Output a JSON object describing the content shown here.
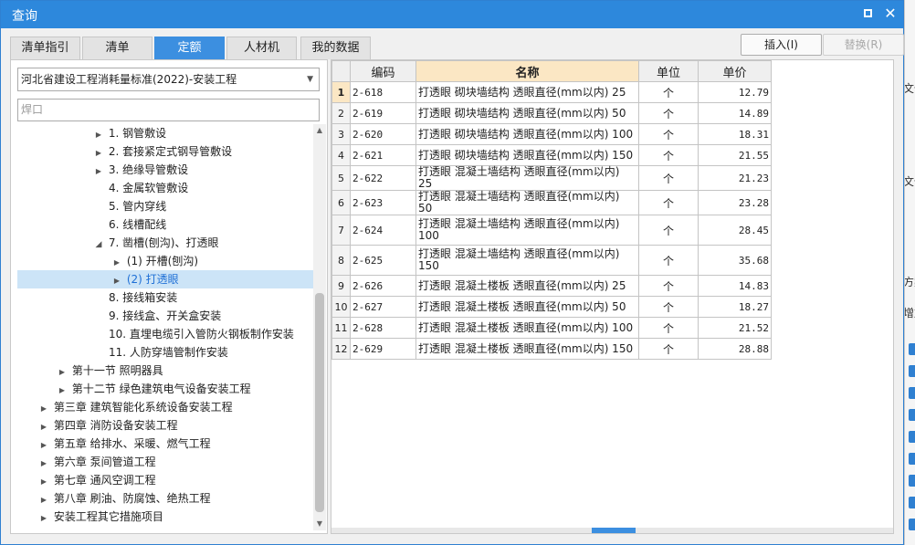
{
  "window": {
    "title": "查询"
  },
  "tabs": [
    "清单指引",
    "清单",
    "定额",
    "人材机",
    "我的数据"
  ],
  "actions": {
    "insert": "插入(I)",
    "replace": "替换(R)"
  },
  "selector": {
    "value": "河北省建设工程消耗量标准(2022)-安装工程"
  },
  "search": {
    "value": "焊口"
  },
  "tree": [
    "1. 钢管敷设",
    "2. 套接紧定式钢导管敷设",
    "3. 绝缘导管敷设",
    "4. 金属软管敷设",
    "5. 管内穿线",
    "6. 线槽配线",
    "7. 凿槽(刨沟)、打透眼",
    "(1) 开槽(刨沟)",
    "(2) 打透眼",
    "8. 接线箱安装",
    "9. 接线盒、开关盒安装",
    "10. 直埋电缆引入管防火钢板制作安装",
    "11. 人防穿墙管制作安装",
    "第十一节 照明器具",
    "第十二节 绿色建筑电气设备安装工程",
    "第三章 建筑智能化系统设备安装工程",
    "第四章 消防设备安装工程",
    "第五章 给排水、采暖、燃气工程",
    "第六章 泵间管道工程",
    "第七章 通风空调工程",
    "第八章 刷油、防腐蚀、绝热工程",
    "安装工程其它措施项目"
  ],
  "table": {
    "headers": [
      "编码",
      "名称",
      "单位",
      "单价"
    ],
    "rows": [
      [
        "1",
        "2-618",
        "打透眼 砌块墙结构 透眼直径(mm以内) 25",
        "个",
        "12.79"
      ],
      [
        "2",
        "2-619",
        "打透眼 砌块墙结构 透眼直径(mm以内) 50",
        "个",
        "14.89"
      ],
      [
        "3",
        "2-620",
        "打透眼 砌块墙结构 透眼直径(mm以内) 100",
        "个",
        "18.31"
      ],
      [
        "4",
        "2-621",
        "打透眼 砌块墙结构 透眼直径(mm以内) 150",
        "个",
        "21.55"
      ],
      [
        "5",
        "2-622",
        "打透眼 混凝土墙结构 透眼直径(mm以内) 25",
        "个",
        "21.23"
      ],
      [
        "6",
        "2-623",
        "打透眼 混凝土墙结构 透眼直径(mm以内) 50",
        "个",
        "23.28"
      ],
      [
        "7",
        "2-624",
        "打透眼 混凝土墙结构 透眼直径(mm以内) 100",
        "个",
        "28.45"
      ],
      [
        "8",
        "2-625",
        "打透眼 混凝土墙结构 透眼直径(mm以内) 150",
        "个",
        "35.68"
      ],
      [
        "9",
        "2-626",
        "打透眼 混凝土楼板 透眼直径(mm以内) 25",
        "个",
        "14.83"
      ],
      [
        "10",
        "2-627",
        "打透眼 混凝土楼板 透眼直径(mm以内) 50",
        "个",
        "18.27"
      ],
      [
        "11",
        "2-628",
        "打透眼 混凝土楼板 透眼直径(mm以内) 100",
        "个",
        "21.52"
      ],
      [
        "12",
        "2-629",
        "打透眼 混凝土楼板 透眼直径(mm以内) 150",
        "个",
        "28.88"
      ]
    ]
  },
  "background": {
    "labels": [
      "文件",
      "文件",
      "方案",
      "增加"
    ]
  },
  "colors": {
    "accent": "#2d88dc",
    "active_tab": "#3c8fe0",
    "selected_row": "#cce4f7",
    "header_highlight": "#fbe7c4"
  }
}
